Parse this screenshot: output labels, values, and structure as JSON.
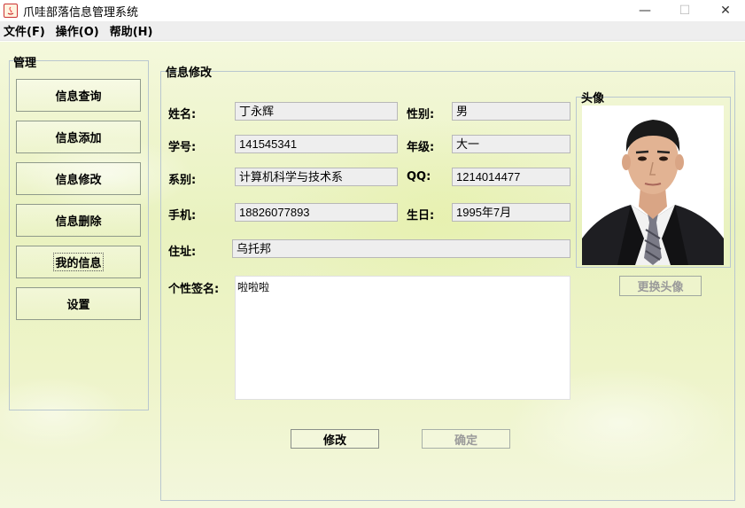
{
  "window": {
    "title": "爪哇部落信息管理系统",
    "minimize": "—",
    "maximize": "☐",
    "close": "✕"
  },
  "menu": [
    {
      "label": "文件(F)"
    },
    {
      "label": "操作(O)"
    },
    {
      "label": "帮助(H)"
    }
  ],
  "sidebar": {
    "title": "管理",
    "items": [
      {
        "label": "信息查询"
      },
      {
        "label": "信息添加"
      },
      {
        "label": "信息修改"
      },
      {
        "label": "信息删除"
      },
      {
        "label": "我的信息",
        "active": true
      },
      {
        "label": "设置"
      }
    ]
  },
  "form": {
    "title": "信息修改",
    "name_label": "姓名:",
    "name": "丁永辉",
    "gender_label": "性别:",
    "gender": "男",
    "id_label": "学号:",
    "id": "141545341",
    "grade_label": "年级:",
    "grade": "大一",
    "dept_label": "系别:",
    "dept": "计算机科学与技术系",
    "qq_label": "QQ:",
    "qq": "1214014477",
    "phone_label": "手机:",
    "phone": "18826077893",
    "birthday_label": "生日:",
    "birthday": "1995年7月",
    "address_label": "住址:",
    "address": "乌托邦",
    "signature_label": "个性签名:",
    "signature": "啦啦啦",
    "modify_button": "修改",
    "confirm_button": "确定"
  },
  "avatar": {
    "title": "头像",
    "change_button": "更换头像"
  }
}
